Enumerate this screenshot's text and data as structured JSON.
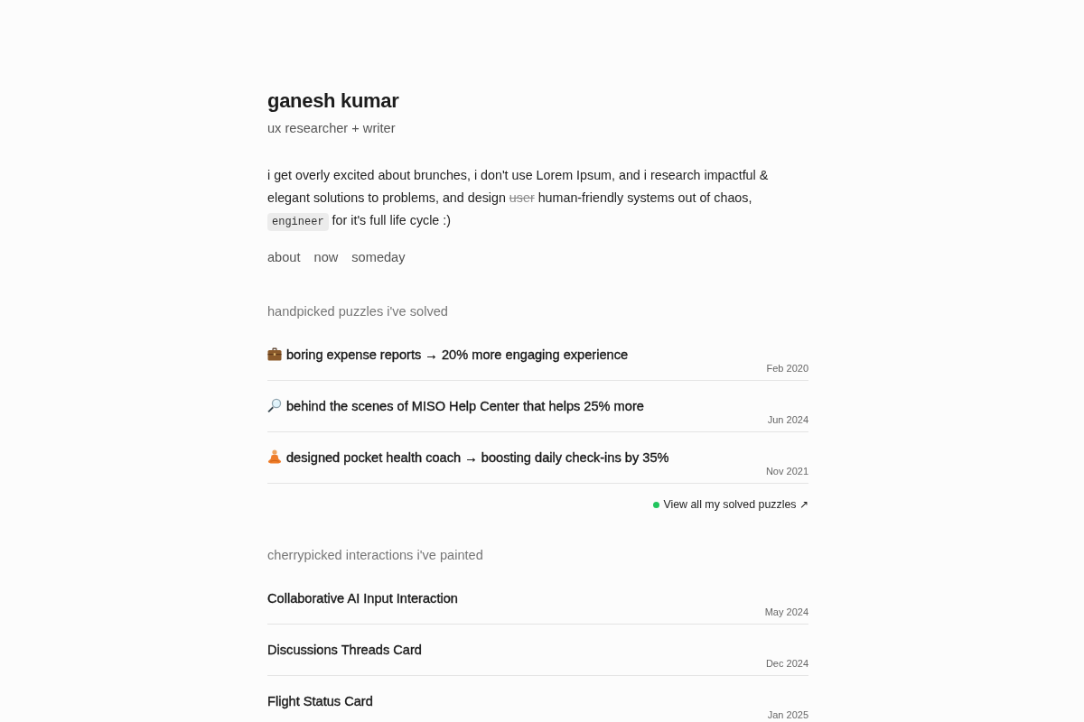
{
  "profile": {
    "name": "ganesh kumar",
    "tagline": "ux researcher + writer"
  },
  "bio": [
    {
      "kind": "text",
      "text": "i get overly excited about brunches, i don't use Lorem Ipsum, and i research impactful & elegant solutions to problems, and design "
    },
    {
      "kind": "struck",
      "text": "user"
    },
    {
      "kind": "text",
      "text": " human-friendly systems out of chaos, "
    },
    {
      "kind": "code",
      "text": "engineer"
    },
    {
      "kind": "text",
      "text": " for it's full life cycle :)"
    }
  ],
  "nav_links": [
    "about",
    "now",
    "someday"
  ],
  "sections": [
    {
      "heading": "handpicked puzzles i've solved",
      "items": [
        {
          "title": "boring expense reports → 20% more engaging experience",
          "date": "Feb 2020"
        },
        {
          "title": "behind the scenes of MISO Help Center that helps 25% more",
          "date": "Jun 2024"
        },
        {
          "title": "designed pocket health coach → boosting daily check-ins by 35%",
          "date": "Nov 2021"
        }
      ],
      "view_all": {
        "label": "View all my solved puzzles ↗"
      }
    },
    {
      "heading": "cherrypicked interactions i've painted",
      "items": [
        {
          "title": "Collaborative AI Input Interaction",
          "date": "May 2024"
        },
        {
          "title": "Discussions Threads Card",
          "date": "Dec 2024"
        },
        {
          "title": "Flight Status Card",
          "date": "Jan 2025"
        }
      ]
    }
  ]
}
